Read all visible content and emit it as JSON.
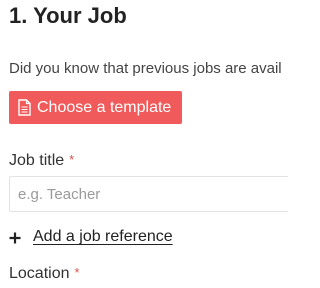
{
  "section": {
    "title": "1. Your Job",
    "intro": "Did you know that previous jobs are avail"
  },
  "template_button": {
    "label": "Choose a template",
    "icon": "document-icon",
    "color": "#f05a5a"
  },
  "job_title": {
    "label": "Job title",
    "required_mark": "*",
    "placeholder": "e.g. Teacher",
    "value": ""
  },
  "add_reference": {
    "label": "Add a job reference",
    "icon": "plus-icon"
  },
  "location": {
    "label": "Location",
    "required_mark": "*"
  },
  "colors": {
    "required": "#d9534f",
    "button": "#f05a5a"
  }
}
